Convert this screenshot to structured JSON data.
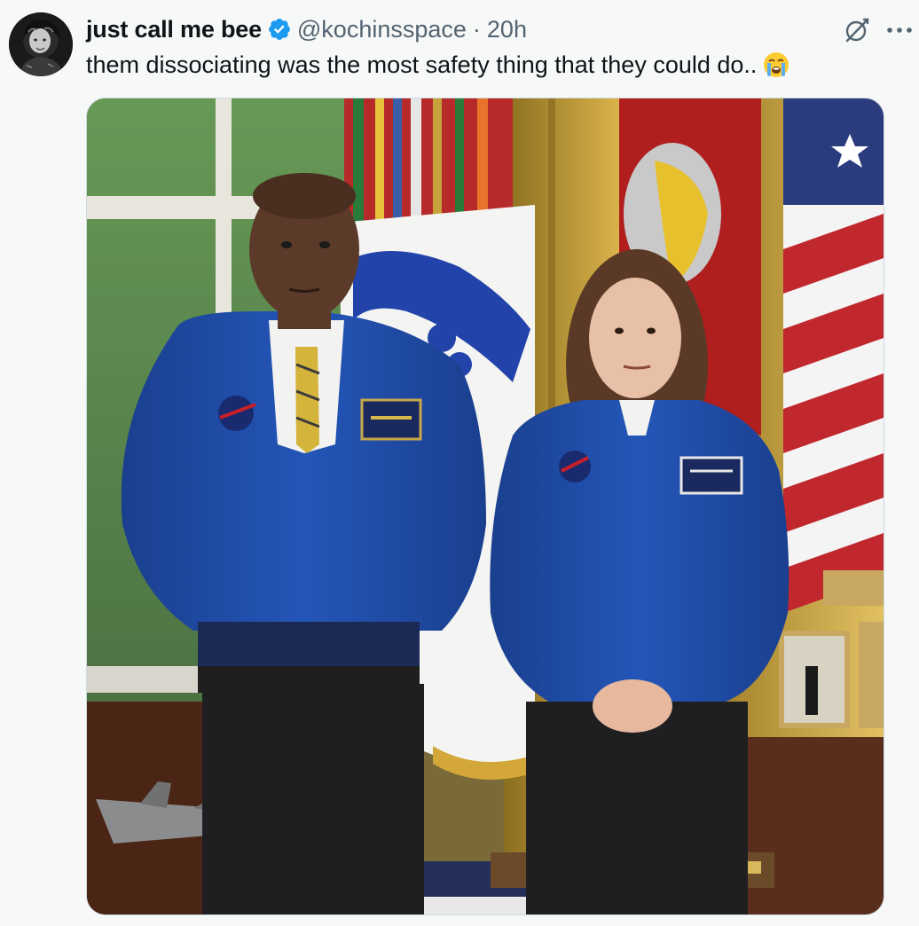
{
  "tweet": {
    "author": {
      "display_name": "just call me bee",
      "handle": "@kochinsspace",
      "verified": true,
      "avatar_icon": "avatar-image"
    },
    "separator": "·",
    "time": "20h",
    "text": "them dissociating was the most safety thing that they could do..",
    "emoji_icon": "loudly-crying-face-icon",
    "actions": {
      "grok_icon": "grok-icon",
      "more_icon": "more-options-icon"
    },
    "media": {
      "type": "photo"
    }
  },
  "colors": {
    "background": "#f7f8f8",
    "text_primary": "#0f1419",
    "text_secondary": "#536471",
    "verified_blue": "#1d9bf0",
    "jacket_blue": "#1f4fa8"
  }
}
